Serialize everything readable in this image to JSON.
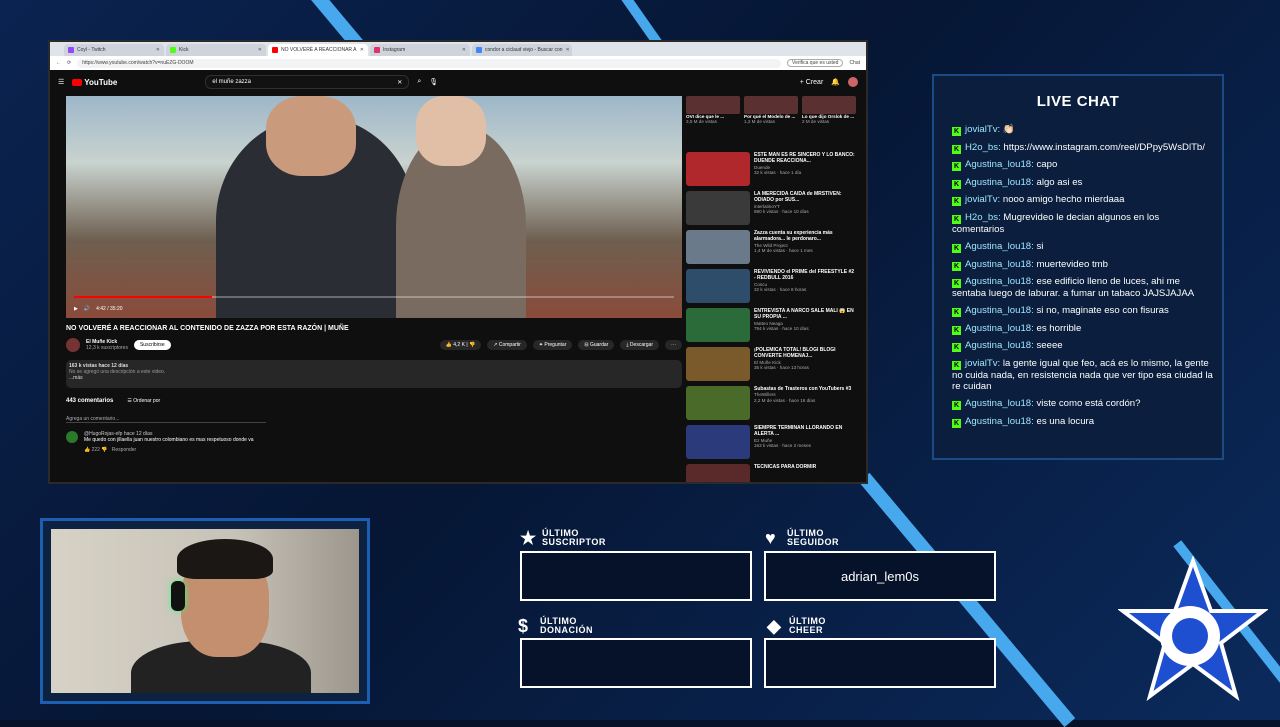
{
  "browser": {
    "tabs": [
      {
        "label": "Coyl - Twitch",
        "color": "#9146ff"
      },
      {
        "label": "Kick",
        "color": "#53fc18"
      },
      {
        "label": "NO VOLVERÉ A REACCIONAR A",
        "color": "#ff0000"
      },
      {
        "label": "Instagram",
        "color": "#e1306c"
      },
      {
        "label": "condor a ciclaud viejo - Buscar con",
        "color": "#4285f4"
      }
    ],
    "url": "https://www.youtube.com/watch?v=nuEZG-DOOM",
    "verify_label": "Verifica que es usted",
    "chat_label": "Chat"
  },
  "youtube": {
    "logo": "YouTube",
    "search_value": "el muñe zazza",
    "create_label": "Crear",
    "time_display": "4:42 / 35:20",
    "progress": 0.23,
    "video_title": "NO VOLVERÉ A REACCIONAR AL CONTENIDO DE ZAZZA POR ESTA RAZÓN | MUÑE",
    "channel_name": "El Muñe Kick",
    "subscribers": "12,3 k suscriptores",
    "subscribe_label": "Suscribirse",
    "likes": "4,2 K",
    "share_label": "Compartir",
    "ask_label": "Preguntar",
    "save_label": "Guardar",
    "download_label": "Descargar",
    "share_tooltip": "Compartir",
    "views": "163 k vistas  hace 12 días",
    "desc_line": "No se agregó una descripción a este video.",
    "desc_more": "...más",
    "comment_count": "443 comentarios",
    "sort_label": "Ordenar por",
    "add_comment": "Agrega un comentario...",
    "comment_user": "@HugoRojas-efp  hace 12 días",
    "comment_text": "Me quedo con jillaella juan nuestro colombiano es mas respetuoso donde va",
    "comment_likes": "222",
    "reply_label": "Responder",
    "sidebar": [
      {
        "title": "ESTE MAN ES RE SINCERO Y LO BANCO: DUENDE REACCIONA...",
        "channel": "Duende",
        "meta": "32 k vistas · hace 1 día",
        "color": "#b0282c"
      },
      {
        "title": "LA MERECIDA CAÍDA de MRSTIVEN: ODIADO por SUS...",
        "channel": "interlatinoYT",
        "meta": "890 k vistas · hace 10 días",
        "color": "#3a3a3a"
      },
      {
        "title": "Zazza cuenta su experiencia más alarmadora... le perdonaro...",
        "channel": "The Wild Project",
        "meta": "1,4 M de vistas · hace 1 mes",
        "color": "#6b7a8a"
      },
      {
        "title": "REVIVIENDO el PRIME del FREESTYLE #2 - REDBULL 2016",
        "channel": "Coscu",
        "meta": "32 k vistas · hace 8 horas",
        "color": "#2d4d6b"
      },
      {
        "title": "ENTREVISTA A NARCO SALE MALI 😱 EN SU PROPIA ...",
        "channel": "Matteo Neaga",
        "meta": "794 k vistas · hace 10 días",
        "color": "#2b6b3a"
      },
      {
        "title": "¡POLÉMICA TOTAL! BLOGI BLOGI CONVERTE HOMENAJ...",
        "channel": "El Muñe Kick",
        "meta": "35 k vistas · hace 13 horas",
        "color": "#7a5a2a"
      },
      {
        "title": "Subastas de Trasteros con YouTubers #3",
        "channel": "TheWillers",
        "meta": "2,2 M de vistas · hace 16 días",
        "color": "#4a6a2a"
      },
      {
        "title": "SIEMPRE TERMINAN LLORANDO EN ALERTA ...",
        "channel": "Ez Muñe",
        "meta": "163 k vistas · hace 2 meses",
        "color": "#2a3a7a"
      },
      {
        "title": "TÉCNICAS PARA DORMIR",
        "channel": "",
        "meta": "",
        "color": "#5a2a2a"
      }
    ],
    "top_cards": [
      {
        "title": "OVI dice que le ...",
        "meta": "3,5 M de vistas"
      },
      {
        "title": "Por qué el Modelo de ...",
        "meta": "1,2 M de vistas"
      },
      {
        "title": "Lo que dijo Orslok de ...",
        "meta": "2 M de vistas"
      }
    ]
  },
  "chat": {
    "title": "LIVE CHAT",
    "messages": [
      {
        "user": "jovialTv:",
        "text": "👏🏻"
      },
      {
        "user": "H2o_bs:",
        "text": "https://www.instagram.com/reel/DPpy5WsDlTb/"
      },
      {
        "user": "Agustina_lou18:",
        "text": "capo"
      },
      {
        "user": "Agustina_lou18:",
        "text": "algo asi es"
      },
      {
        "user": "jovialTv:",
        "text": "nooo amigo hecho mierdaaa"
      },
      {
        "user": "H2o_bs:",
        "text": "Mugrevideo le decian algunos en los comentarios"
      },
      {
        "user": "Agustina_lou18:",
        "text": "si"
      },
      {
        "user": "Agustina_lou18:",
        "text": "muertevideo tmb"
      },
      {
        "user": "Agustina_lou18:",
        "text": "ese edificio lleno de luces, ahi me sentaba luego de laburar. a fumar un tabaco JAJSJAJAA"
      },
      {
        "user": "Agustina_lou18:",
        "text": "si no, maginate eso con fisuras"
      },
      {
        "user": "Agustina_lou18:",
        "text": "es horrible"
      },
      {
        "user": "Agustina_lou18:",
        "text": "seeee"
      },
      {
        "user": "jovialTv:",
        "text": "la gente igual que feo, acá es lo mismo, la gente no cuida nada, en resistencia nada que ver tipo esa ciudad la re cuidan"
      },
      {
        "user": "Agustina_lou18:",
        "text": "viste como está cordón?"
      },
      {
        "user": "Agustina_lou18:",
        "text": "es una locura"
      }
    ]
  },
  "alerts": {
    "ultimo": "ÚLTIMO",
    "suscriptor": "SUSCRIPTOR",
    "seguidor": "SEGUIDOR",
    "donacion": "DONACIÓN",
    "cheer": "CHEER",
    "seguidor_value": "adrian_lem0s",
    "suscriptor_value": "",
    "donacion_value": "",
    "cheer_value": ""
  }
}
